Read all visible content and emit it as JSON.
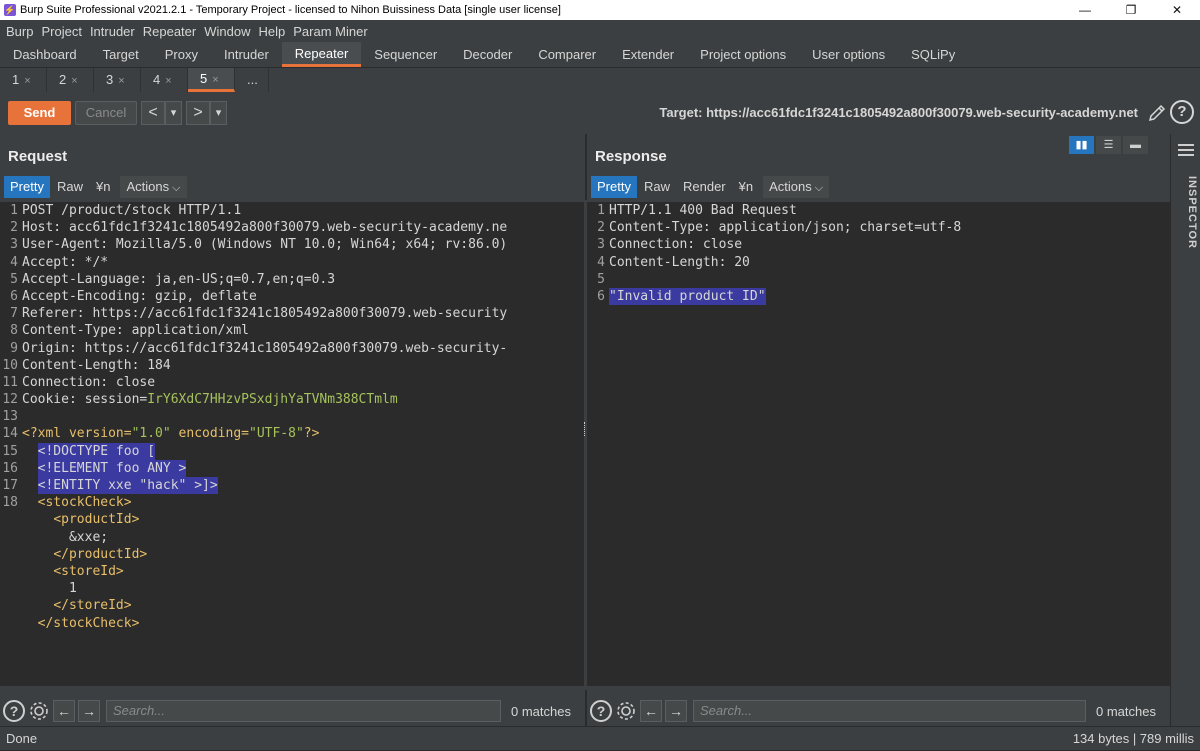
{
  "window": {
    "title": "Burp Suite Professional v2021.2.1 - Temporary Project - licensed to Nihon Buissiness Data [single user license]",
    "minimize": "—",
    "restore": "❐",
    "close": "✕"
  },
  "menu": [
    "Burp",
    "Project",
    "Intruder",
    "Repeater",
    "Window",
    "Help",
    "Param Miner"
  ],
  "main_tabs": [
    "Dashboard",
    "Target",
    "Proxy",
    "Intruder",
    "Repeater",
    "Sequencer",
    "Decoder",
    "Comparer",
    "Extender",
    "Project options",
    "User options",
    "SQLiPy"
  ],
  "active_main_tab": "Repeater",
  "sub_tabs": [
    "1",
    "2",
    "3",
    "4",
    "5"
  ],
  "sub_tab_close": "×",
  "sub_tab_more": "...",
  "active_sub_tab": "5",
  "toolbar": {
    "send_label": "Send",
    "cancel_label": "Cancel",
    "prev": "<",
    "prev_dropdown": "▾",
    "next": ">",
    "next_dropdown": "▾",
    "target": "Target: https://acc61fdc1f3241c1805492a800f30079.web-security-academy.net",
    "help": "?"
  },
  "request": {
    "title": "Request",
    "views": [
      "Pretty",
      "Raw",
      "¥n"
    ],
    "active_view": "Pretty",
    "actions_label": "Actions",
    "lines": [
      {
        "n": "1",
        "segs": [
          {
            "t": "POST /product/stock HTTP/1.1",
            "c": "code"
          }
        ]
      },
      {
        "n": "2",
        "segs": [
          {
            "t": "Host: acc61fdc1f3241c1805492a800f30079.web-security-academy.ne",
            "c": "code"
          }
        ]
      },
      {
        "n": "3",
        "segs": [
          {
            "t": "User-Agent: Mozilla/5.0 (Windows NT 10.0; Win64; x64; rv:86.0)",
            "c": "code"
          }
        ]
      },
      {
        "n": "4",
        "segs": [
          {
            "t": "Accept: */*",
            "c": "code"
          }
        ]
      },
      {
        "n": "5",
        "segs": [
          {
            "t": "Accept-Language: ja,en-US;q=0.7,en;q=0.3",
            "c": "code"
          }
        ]
      },
      {
        "n": "6",
        "segs": [
          {
            "t": "Accept-Encoding: gzip, deflate",
            "c": "code"
          }
        ]
      },
      {
        "n": "7",
        "segs": [
          {
            "t": "Referer: https://acc61fdc1f3241c1805492a800f30079.web-security",
            "c": "code"
          }
        ]
      },
      {
        "n": "8",
        "segs": [
          {
            "t": "Content-Type: application/xml",
            "c": "code"
          }
        ]
      },
      {
        "n": "9",
        "segs": [
          {
            "t": "Origin: https://acc61fdc1f3241c1805492a800f30079.web-security-",
            "c": "code"
          }
        ]
      },
      {
        "n": "10",
        "segs": [
          {
            "t": "Content-Length: 184",
            "c": "code"
          }
        ]
      },
      {
        "n": "11",
        "segs": [
          {
            "t": "Connection: close",
            "c": "code"
          }
        ]
      },
      {
        "n": "12",
        "segs": [
          {
            "t": "Cookie: session=",
            "c": "code"
          },
          {
            "t": "IrY6XdC7HHzvPSxdjhYaTVNm388CTmlm",
            "c": "str"
          }
        ]
      },
      {
        "n": "13",
        "segs": []
      },
      {
        "n": "14",
        "segs": [
          {
            "t": "<?xml version=",
            "c": "tag"
          },
          {
            "t": "\"1.0\"",
            "c": "str"
          },
          {
            "t": " encoding=",
            "c": "tag"
          },
          {
            "t": "\"UTF-8\"",
            "c": "str"
          },
          {
            "t": "?>",
            "c": "tag"
          }
        ]
      },
      {
        "n": "15",
        "segs": [
          {
            "t": "  ",
            "c": "code"
          },
          {
            "t": "<!DOCTYPE foo [",
            "c": "sel"
          }
        ]
      },
      {
        "n": "16",
        "segs": [
          {
            "t": "  ",
            "c": "code"
          },
          {
            "t": "<!ELEMENT foo ANY >",
            "c": "sel"
          }
        ]
      },
      {
        "n": "17",
        "segs": [
          {
            "t": "  ",
            "c": "code"
          },
          {
            "t": "<!ENTITY xxe \"hack\" >]>",
            "c": "sel"
          }
        ]
      },
      {
        "n": "18",
        "segs": [
          {
            "t": "  ",
            "c": "code"
          },
          {
            "t": "<stockCheck>",
            "c": "tag"
          }
        ]
      },
      {
        "n": "",
        "segs": [
          {
            "t": "    ",
            "c": "code"
          },
          {
            "t": "<productId>",
            "c": "tag"
          }
        ]
      },
      {
        "n": "",
        "segs": [
          {
            "t": "      &xxe;",
            "c": "code"
          }
        ]
      },
      {
        "n": "",
        "segs": [
          {
            "t": "    ",
            "c": "code"
          },
          {
            "t": "</productId>",
            "c": "tag"
          }
        ]
      },
      {
        "n": "",
        "segs": [
          {
            "t": "    ",
            "c": "code"
          },
          {
            "t": "<storeId>",
            "c": "tag"
          }
        ]
      },
      {
        "n": "",
        "segs": [
          {
            "t": "      1",
            "c": "code"
          }
        ]
      },
      {
        "n": "",
        "segs": [
          {
            "t": "    ",
            "c": "code"
          },
          {
            "t": "</storeId>",
            "c": "tag"
          }
        ]
      },
      {
        "n": "",
        "segs": [
          {
            "t": "  ",
            "c": "code"
          },
          {
            "t": "</stockCheck>",
            "c": "tag"
          }
        ]
      }
    ],
    "search_placeholder": "Search...",
    "matches": "0 matches"
  },
  "response": {
    "title": "Response",
    "views": [
      "Pretty",
      "Raw",
      "Render",
      "¥n"
    ],
    "active_view": "Pretty",
    "actions_label": "Actions",
    "lines": [
      {
        "n": "1",
        "segs": [
          {
            "t": "HTTP/1.1 400 Bad Request",
            "c": "code"
          }
        ]
      },
      {
        "n": "2",
        "segs": [
          {
            "t": "Content-Type: application/json; charset=utf-8",
            "c": "code"
          }
        ]
      },
      {
        "n": "3",
        "segs": [
          {
            "t": "Connection: close",
            "c": "code"
          }
        ]
      },
      {
        "n": "4",
        "segs": [
          {
            "t": "Content-Length: 20",
            "c": "code"
          }
        ]
      },
      {
        "n": "5",
        "segs": []
      },
      {
        "n": "6",
        "segs": [
          {
            "t": "\"Invalid product ID\"",
            "c": "sel"
          }
        ]
      }
    ],
    "search_placeholder": "Search...",
    "matches": "0 matches"
  },
  "inspector_label": "INSPECTOR",
  "status": {
    "left": "Done",
    "right": "134 bytes | 789 millis"
  },
  "colors": {
    "accent": "#e8733a",
    "active_view": "#2675bf",
    "selection": "#3a3aa0",
    "xml_tag": "#e8bf6a",
    "string": "#a5c25c"
  }
}
